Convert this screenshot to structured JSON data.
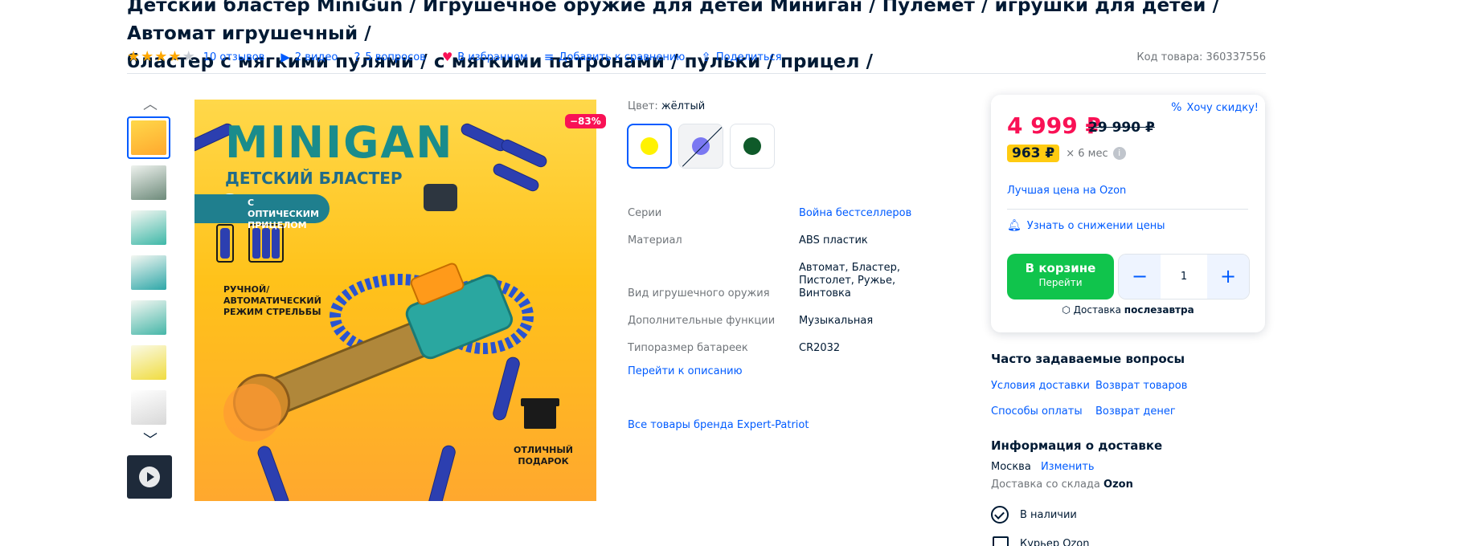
{
  "product": {
    "title_line1": "Детский бластер MiniGun / Игрушечное оружие для детей Миниган / Пулемет / игрушки для детей / Автомат игрушечный /",
    "title_line2": "бластер с мягкими пулями / с мягкими патронами / пульки / прицел /",
    "rating_stars": 4,
    "reviews": "10 отзывов",
    "videos": "2 видео",
    "questions": "5 вопросов",
    "favorite": "В избранном",
    "compare": "Добавить к сравнению",
    "share": "Поделиться",
    "code": "Код товара: 360337556"
  },
  "image": {
    "discount_badge": "−83%",
    "banner_title": "MINIGAN",
    "banner_subtitle": "ДЕТСКИЙ БЛАСТЕР",
    "pill_text": "С ОПТИЧЕСКИМ ПРИЦЕЛОМ",
    "mode_text": "РУЧНОЙ/АВТОМАТИЧЕСКИЙ РЕЖИМ СТРЕЛЬБЫ",
    "gift_text": "ОТЛИЧНЫЙ ПОДАРОК"
  },
  "color": {
    "label": "Цвет:",
    "selected": "жёлтый",
    "swatches": [
      "#fff200",
      "#7b78f2",
      "#0f5a2a"
    ]
  },
  "specs": [
    {
      "name": "Серии",
      "value": "Война бестселлеров",
      "link": true
    },
    {
      "name": "Материал",
      "value": "ABS пластик",
      "link": false
    },
    {
      "name": "Вид игрушечного оружия",
      "value": "Автомат, Бластер, Пистолет, Ружье, Винтовка",
      "link": false
    },
    {
      "name": "Дополнительные функции",
      "value": "Музыкальная",
      "link": false
    },
    {
      "name": "Типоразмер батареек",
      "value": "CR2032",
      "link": false
    }
  ],
  "links": {
    "to_description": "Перейти к описанию",
    "brand_all": "Все товары бренда Expert-Patriot"
  },
  "buy": {
    "want_discount": "Хочу скидку!",
    "price": "4 999 ₽",
    "old_price": "29 990 ₽",
    "installment": "963 ₽",
    "installment_term": "× 6 мес",
    "best_price": "Лучшая цена на Ozon",
    "notify": "Узнать о снижении цены",
    "in_cart": "В корзине",
    "go": "Перейти",
    "qty_minus": "−",
    "qty": "1",
    "qty_plus": "+",
    "delivery_label": "Доставка",
    "delivery_when": "послезавтра"
  },
  "faq": {
    "title": "Часто задаваемые вопросы",
    "links": [
      "Условия доставки",
      "Возврат товаров",
      "Способы оплаты",
      "Возврат денег"
    ]
  },
  "delivery": {
    "title": "Информация о доставке",
    "city": "Москва",
    "change": "Изменить",
    "warehouse_label": "Доставка со склада",
    "warehouse": "Ozon",
    "stock": "В наличии",
    "cut_text": "Курьер Ozon"
  }
}
